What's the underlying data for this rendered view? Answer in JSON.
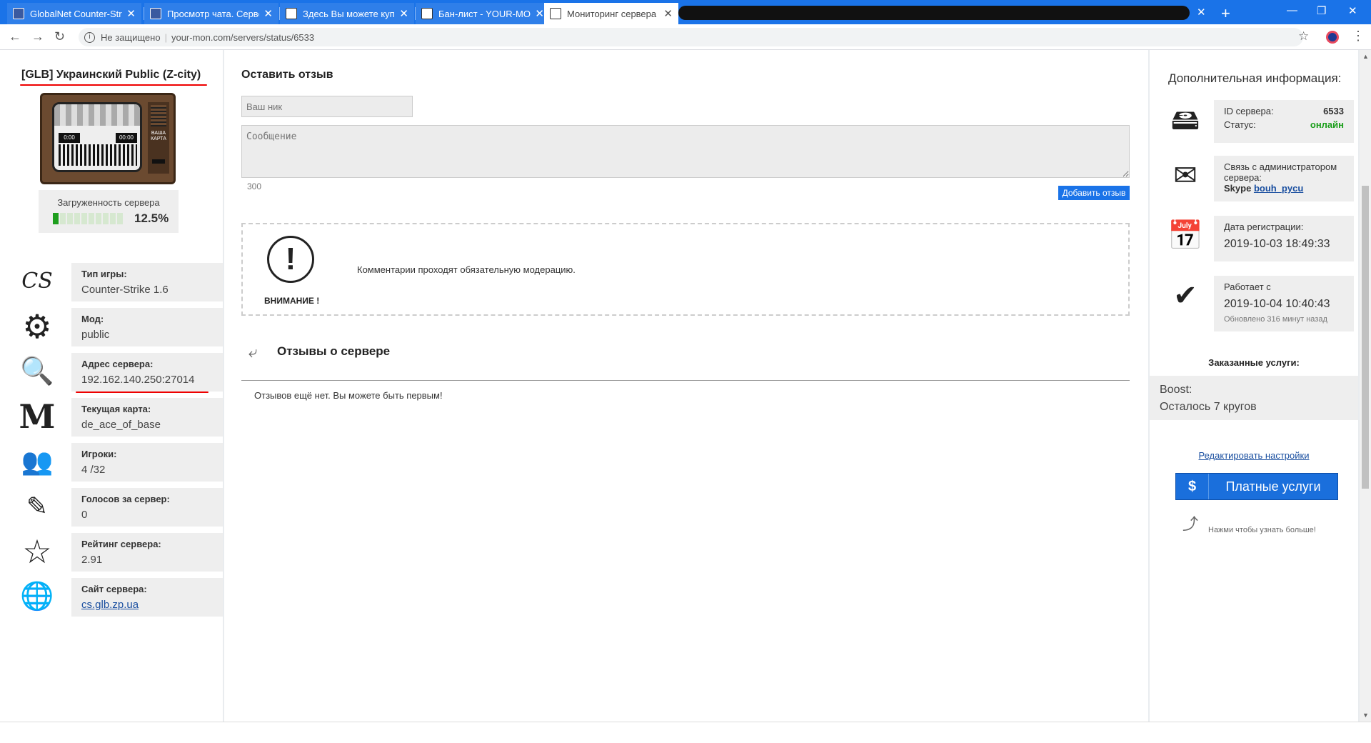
{
  "browser": {
    "tabs": [
      {
        "title": "GlobalNet Counter-Stri",
        "active": false
      },
      {
        "title": "Просмотр чата. Серве",
        "active": false
      },
      {
        "title": "Здесь Вы можете купи",
        "active": false
      },
      {
        "title": "Бан-лист - YOUR-MON",
        "active": false
      },
      {
        "title": "Мониторинг сервера",
        "active": true
      }
    ],
    "security_label": "Не защищено",
    "url": "your-mon.com/servers/status/6533"
  },
  "server": {
    "title": "[GLB] Украинский Public (Z-city)",
    "map_badge": "ВАША КАРТА",
    "timer_left": "0:00",
    "timer_right": "00:00",
    "load_label": "Загруженность сервера",
    "load_value": "12.5%",
    "load_fraction": 0.125
  },
  "info": [
    {
      "label": "Тип игры:",
      "value": "Counter-Strike 1.6",
      "icon": "cs-version-icon"
    },
    {
      "label": "Мод:",
      "value": "public",
      "icon": "gear-icon"
    },
    {
      "label": "Адрес сервера:",
      "value": "192.162.140.250:27014",
      "icon": "magnifier-icon"
    },
    {
      "label": "Текущая карта:",
      "value": "de_ace_of_base",
      "icon": "map-m-icon"
    },
    {
      "label": "Игроки:",
      "value": "4 /32",
      "icon": "players-icon"
    },
    {
      "label": "Голосов за сервер:",
      "value": "0",
      "icon": "pen-icon"
    },
    {
      "label": "Рейтинг сервера:",
      "value": "2.91",
      "icon": "star-icon"
    },
    {
      "label": "Сайт сервера:",
      "value": "cs.glb.zp.ua",
      "icon": "globe-icon"
    }
  ],
  "review_form": {
    "title": "Оставить отзыв",
    "nick_placeholder": "Ваш ник",
    "message_placeholder": "Сообщение",
    "counter": "300",
    "submit_label": "Добавить отзыв"
  },
  "notice": {
    "symbol": "!",
    "warning": "ВНИМАНИЕ !",
    "text": "Комментарии проходят обязательную модерацию."
  },
  "reviews": {
    "title": "Отзывы о сервере",
    "empty": "Отзывов ещё нет. Вы можете быть первым!"
  },
  "right": {
    "heading": "Дополнительная информация:",
    "id_label": "ID сервера:",
    "id_value": "6533",
    "status_label": "Статус:",
    "status_value": "онлайн",
    "status_color": "#1a9e1a",
    "admin_label": "Связь с администратором сервера:",
    "skype_label": "Skype",
    "skype_value": "bouh_pycu",
    "reg_label": "Дата регистрации:",
    "reg_value": "2019-10-03 18:49:33",
    "uptime_label": "Работает с",
    "uptime_value": "2019-10-04 10:40:43",
    "updated": "Обновлено 316 минут назад",
    "ordered": "Заказанные услуги:",
    "boost_name": "Boost:",
    "boost_left": "Осталось 7 кругов",
    "edit_link": "Редактировать настройки",
    "paid_symbol": "$",
    "paid_label": "Платные услуги",
    "hint": "Нажми чтобы узнать больше!"
  },
  "colors": {
    "chrome_blue": "#1a73e8",
    "accent_blue": "#1a6fdc",
    "load_green": "#1e9e1e"
  }
}
